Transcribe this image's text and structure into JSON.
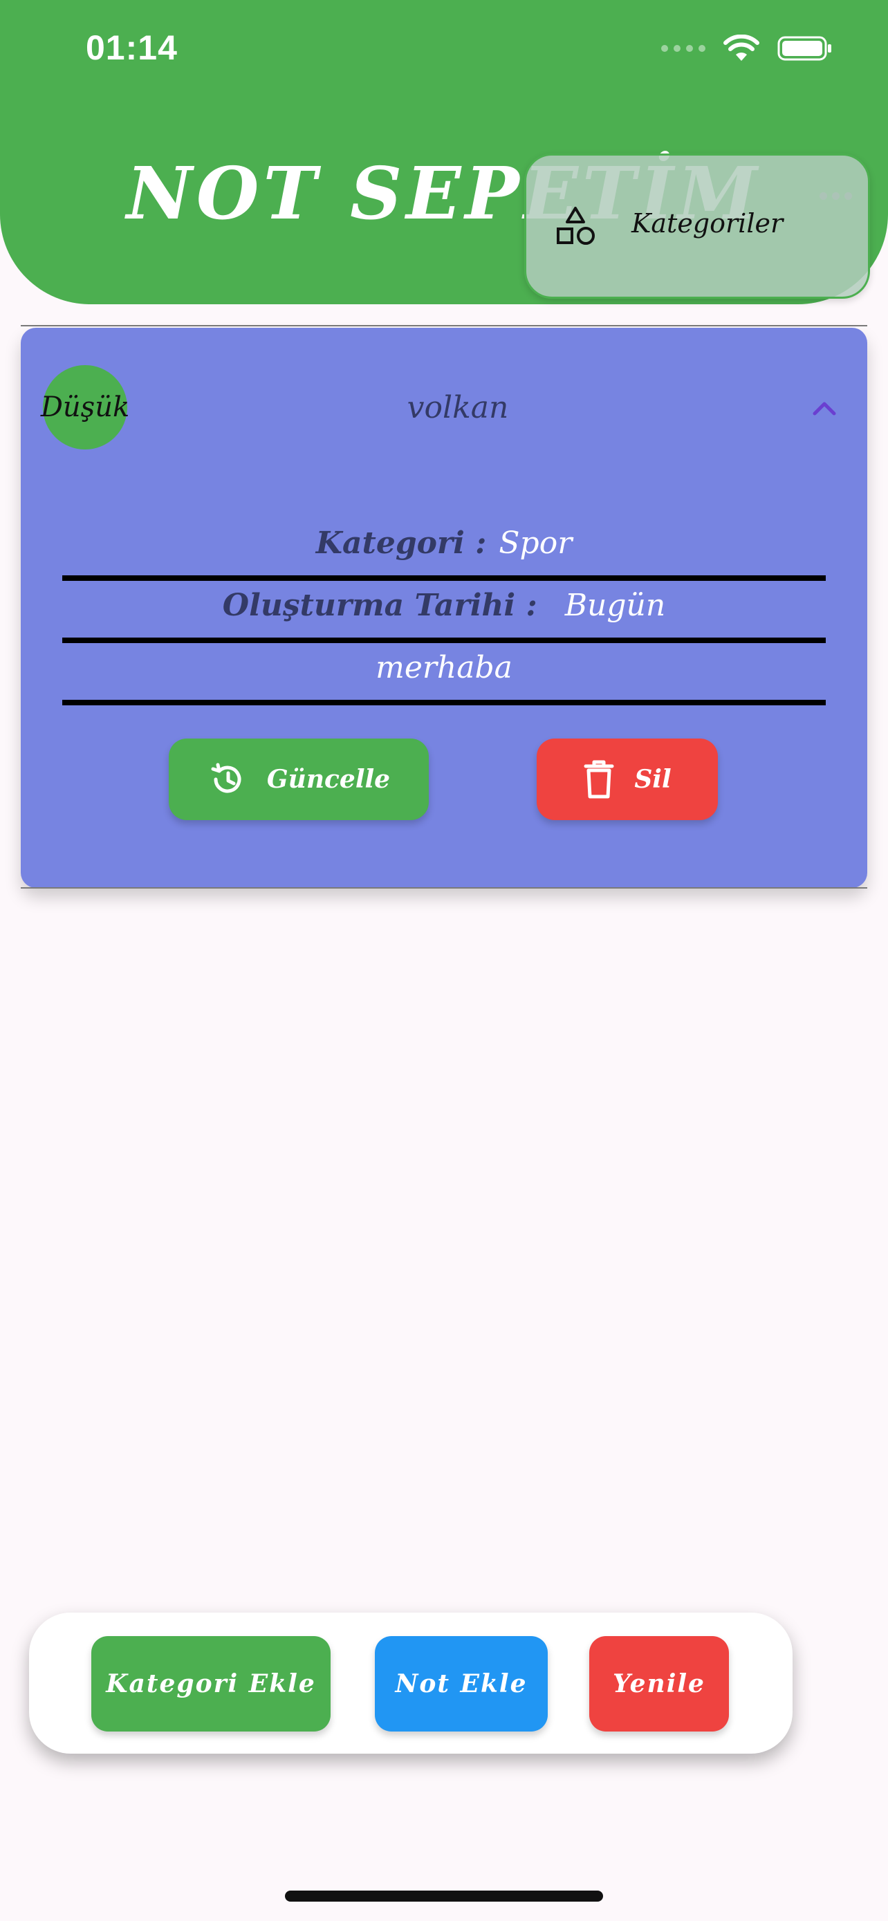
{
  "status_bar": {
    "time": "01:14"
  },
  "header": {
    "title": "NOT SEPETİM"
  },
  "popup_menu": {
    "item_label": "Kategoriler",
    "icon": "shapes-icon"
  },
  "note": {
    "priority": "Düşük",
    "title": "volkan",
    "category_key": "Kategori :",
    "category_value": "Spor",
    "date_key": "Oluşturma Tarihi :",
    "date_value": "Bugün",
    "content": "merhaba",
    "update_label": "Güncelle",
    "delete_label": "Sil"
  },
  "bottom_bar": {
    "add_category_label": "Kategori Ekle",
    "add_note_label": "Not Ekle",
    "refresh_label": "Yenile"
  },
  "colors": {
    "header": "#4caf50",
    "card": "#7784e1",
    "green": "#4caf50",
    "blue": "#2196f3",
    "red": "#ef4340"
  }
}
